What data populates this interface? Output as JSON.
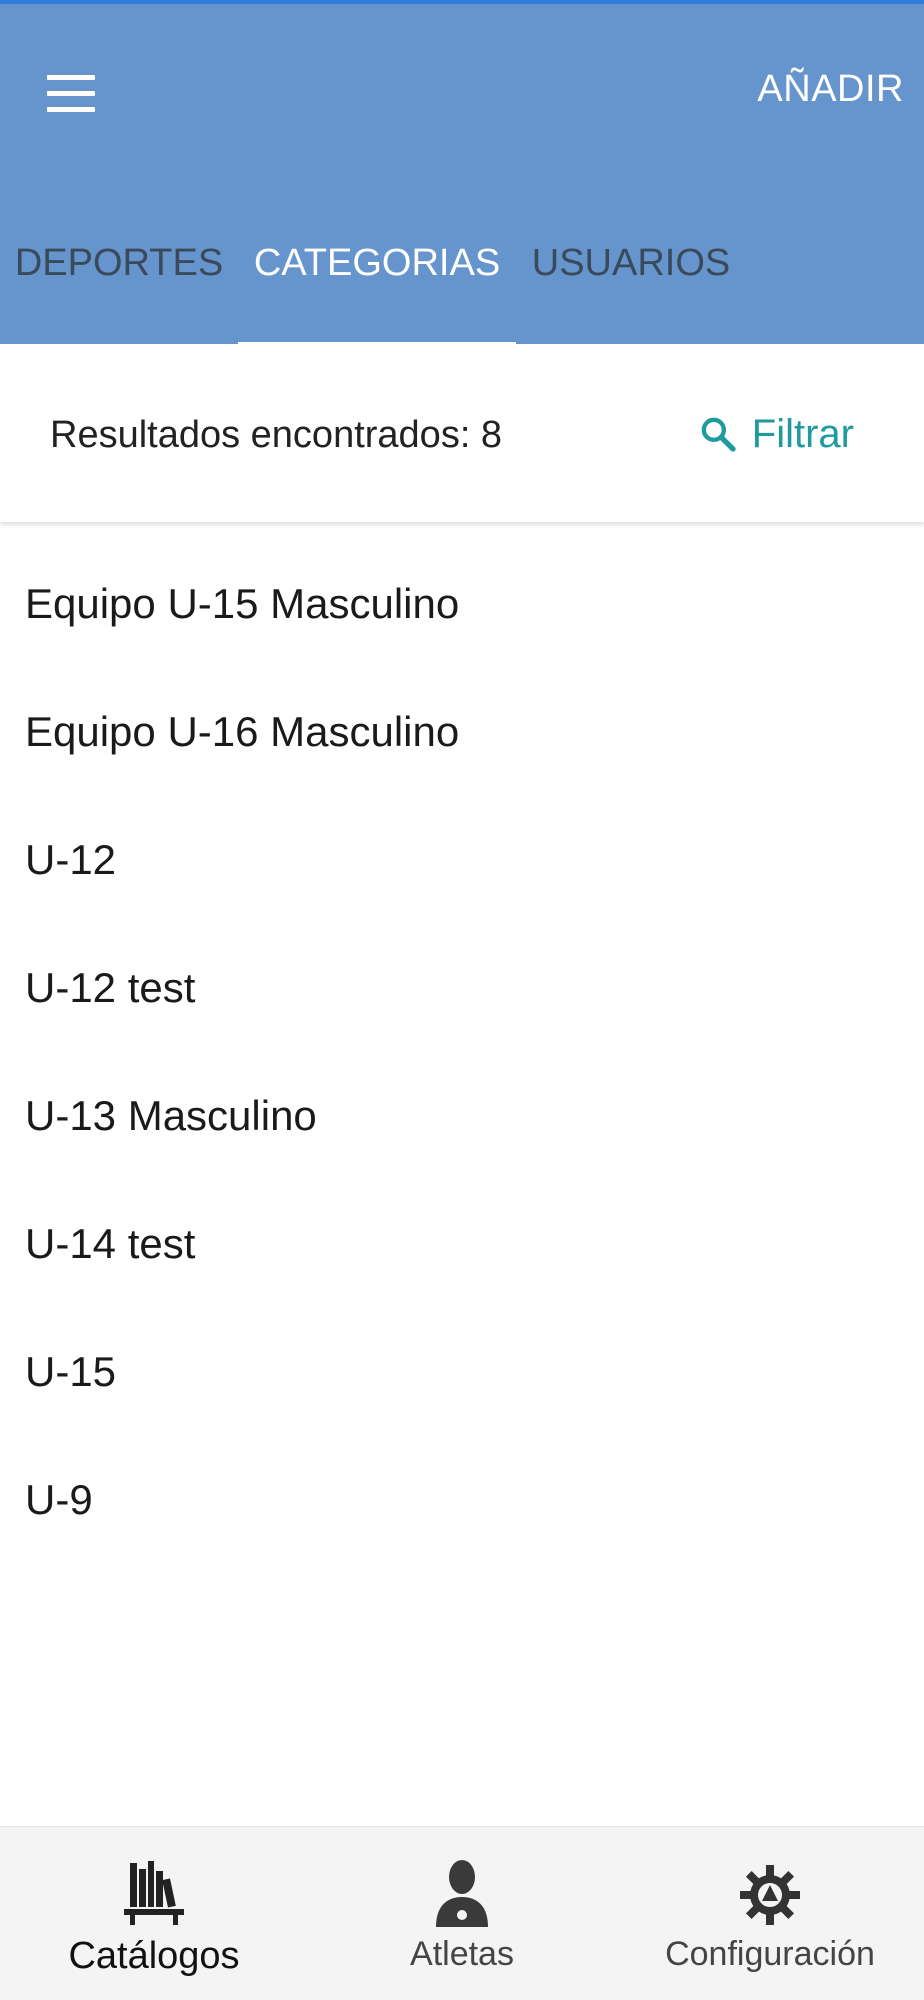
{
  "header": {
    "add_label": "AÑADIR",
    "color": "#6694cc",
    "tabs": [
      {
        "label": "DEPORTES",
        "active": false
      },
      {
        "label": "CATEGORIAS",
        "active": true
      },
      {
        "label": "USUARIOS",
        "active": false
      }
    ]
  },
  "results": {
    "text": "Resultados encontrados: 8",
    "filter_label": "Filtrar",
    "accent_color": "#1f9b9e"
  },
  "categories": [
    "Equipo U-15 Masculino",
    "Equipo U-16 Masculino",
    "U-12",
    "U-12 test",
    "U-13 Masculino",
    "U-14 test",
    "U-15",
    "U-9"
  ],
  "bottom_nav": [
    {
      "label": "Catálogos",
      "icon": "books-icon",
      "active": true
    },
    {
      "label": "Atletas",
      "icon": "athlete-icon",
      "active": false
    },
    {
      "label": "Configuración",
      "icon": "gear-icon",
      "active": false
    }
  ]
}
